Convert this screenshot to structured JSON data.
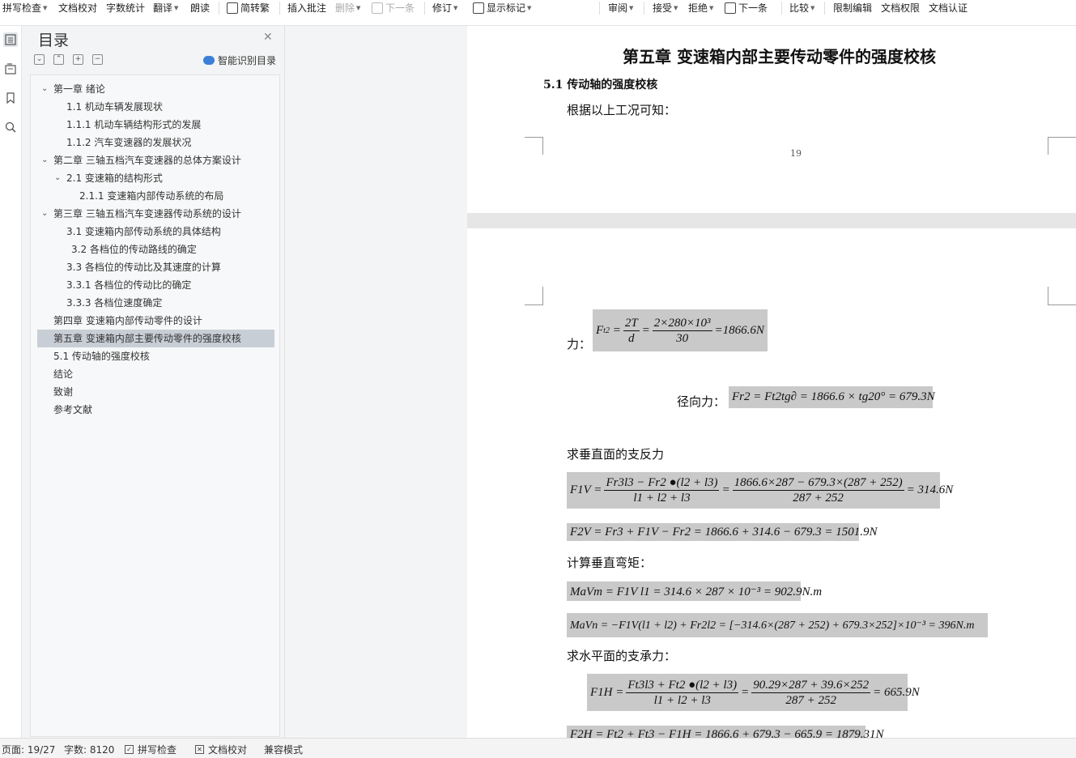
{
  "toolbar": {
    "spell_check": "拼写检查",
    "doc_proof": "文档校对",
    "word_count": "字数统计",
    "translate": "翻译",
    "read_aloud": "朗读",
    "trad_simp": "简转繁",
    "insert_comment": "插入批注",
    "delete": "删除",
    "next_comment": "下一条",
    "revise": "修订",
    "show_markup": "显示标记",
    "review": "审阅",
    "accept": "接受",
    "reject": "拒绝",
    "next_change": "下一条",
    "compare": "比较",
    "restrict_edit": "限制编辑",
    "doc_permission": "文档权限",
    "doc_certify": "文档认证"
  },
  "toc": {
    "title": "目录",
    "smart_toc": "智能识别目录",
    "items": [
      {
        "label": "第一章  绪论",
        "level": 1,
        "expanded": true
      },
      {
        "label": "1.1  机动车辆发展现状",
        "level": 2
      },
      {
        "label": "1.1.1  机动车辆结构形式的发展",
        "level": 2
      },
      {
        "label": "1.1.2 汽车变速器的发展状况",
        "level": 2
      },
      {
        "label": "第二章  三轴五档汽车变速器的总体方案设计",
        "level": 1,
        "expanded": true
      },
      {
        "label": "2.1  变速箱的结构形式",
        "level": 2,
        "expanded": true
      },
      {
        "label": "2.1.1  变速箱内部传动系统的布局",
        "level": 3
      },
      {
        "label": "第三章  三轴五档汽车变速器传动系统的设计",
        "level": 1,
        "expanded": true
      },
      {
        "label": "3.1 变速箱内部传动系统的具体结构",
        "level": 2
      },
      {
        "label": "3.2 各档位的传动路线的确定",
        "level": 2
      },
      {
        "label": "3.3  各档位的传动比及其速度的计算",
        "level": 2
      },
      {
        "label": "3.3.1  各档位的传动比的确定",
        "level": 2
      },
      {
        "label": "3.3.3  各档位速度确定",
        "level": 2
      },
      {
        "label": "第四章  变速箱内部传动零件的设计",
        "level": 1
      },
      {
        "label": "第五章  变速箱内部主要传动零件的强度校核",
        "level": 1,
        "selected": true
      },
      {
        "label": "5.1 传动轴的强度校核",
        "level": 1
      },
      {
        "label": "结论",
        "level": 1
      },
      {
        "label": "致谢",
        "level": 1
      },
      {
        "label": "参考文献",
        "level": 1
      }
    ]
  },
  "document": {
    "chapter_title": "第五章  变速箱内部主要传动零件的强度校核",
    "section_title": "5.1 传动轴的强度校核",
    "intro": "根据以上工况可知：",
    "page_number": "19",
    "force_label": "力：",
    "radial_label": "径向力：",
    "vertical_support": "求垂直面的支反力",
    "vertical_moment": "计算垂直弯矩：",
    "horizontal_support": "求水平面的支承力：",
    "formulas": {
      "ft2_lhs": "F",
      "ft2_sub": "t2",
      "ft2_num1": "2T",
      "ft2_den1": "d",
      "ft2_num2": "2×280×10³",
      "ft2_den2": "30",
      "ft2_result": "=1866.6N",
      "fr2": "Fr2 = Ft2tg∂ = 1866.6 × tg20° = 679.3N",
      "f1v_lhs": "F1V =",
      "f1v_num1": "Fr3l3 − Fr2 ●(l2 + l3)",
      "f1v_den1": "l1 + l2 + l3",
      "f1v_num2": "1866.6×287 − 679.3×(287 + 252)",
      "f1v_den2": "287 + 252",
      "f1v_result": "= 314.6N",
      "f2v": "F2V = Fr3 + F1V − Fr2 = 1866.6 + 314.6 − 679.3 = 1501.9N",
      "mavm": "MaVm = F1V l1 = 314.6 × 287 × 10⁻³ = 902.9N.m",
      "mavn": "MaVn = −F1V(l1 + l2) + Fr2l2 = [−314.6×(287 + 252) + 679.3×252]×10⁻³ = 396N.m",
      "f1h_lhs": "F1H =",
      "f1h_num1": "Ft3l3 + Ft2 ●(l2 + l3)",
      "f1h_den1": "l1 + l2 + l3",
      "f1h_num2": "90.29×287 + 39.6×252",
      "f1h_den2": "287 + 252",
      "f1h_result": "= 665.9N",
      "f2h": "F2H = Ft2 + Ft3 − F1H = 1866.6 + 679.3 − 665.9 = 1879.31N"
    }
  },
  "status": {
    "page": "页面: 19/27",
    "word_count": "字数: 8120",
    "spell_check": "拼写检查",
    "doc_proof": "文档校对",
    "compat_mode": "兼容模式"
  }
}
